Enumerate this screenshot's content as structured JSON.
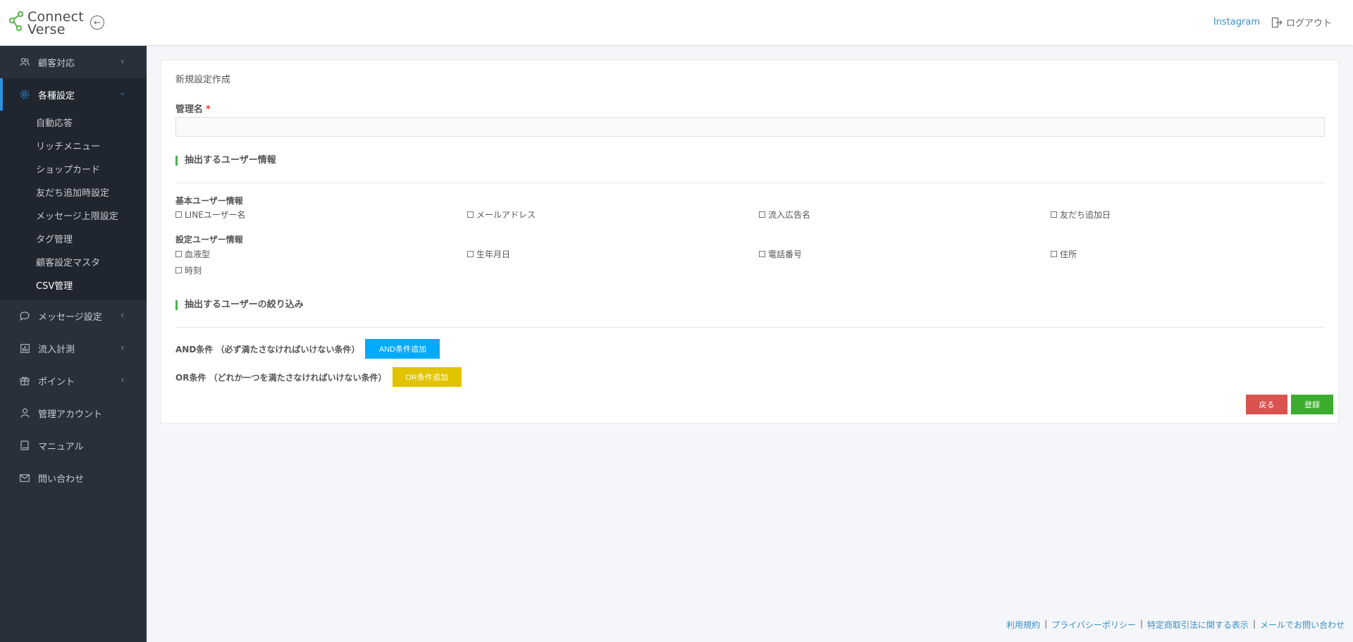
{
  "header": {
    "logo_line1": "Connect",
    "logo_line2": "Verse",
    "instagram_link": "Instagram",
    "logout_label": "ログアウト"
  },
  "sidebar": {
    "items": [
      {
        "label": "顧客対応",
        "icon": "users-icon"
      },
      {
        "label": "各種設定",
        "icon": "gear-icon",
        "active": true
      },
      {
        "label": "メッセージ設定",
        "icon": "chat-icon"
      },
      {
        "label": "流入計測",
        "icon": "chart-icon"
      },
      {
        "label": "ポイント",
        "icon": "gift-icon"
      },
      {
        "label": "管理アカウント",
        "icon": "user-icon"
      },
      {
        "label": "マニュアル",
        "icon": "book-icon"
      },
      {
        "label": "問い合わせ",
        "icon": "mail-icon"
      }
    ],
    "sub_items": [
      "自動応答",
      "リッチメニュー",
      "ショップカード",
      "友だち追加時設定",
      "メッセージ上限設定",
      "タグ管理",
      "顧客設定マスタ",
      "CSV管理"
    ]
  },
  "form": {
    "title": "新規設定作成",
    "name_label": "管理名",
    "required_mark": "*",
    "name_value": "",
    "section_extract": "抽出するユーザー情報",
    "basic_group": "基本ユーザー情報",
    "basic_options": [
      "LINEユーザー名",
      "メールアドレス",
      "流入広告名",
      "友だち追加日"
    ],
    "settings_group": "設定ユーザー情報",
    "settings_options": [
      "血液型",
      "生年月日",
      "電話番号",
      "住所",
      "時刻"
    ],
    "section_filter": "抽出するユーザーの絞り込み",
    "and_label": "AND条件 （必ず満たさなければいけない条件）",
    "and_button": "AND条件追加",
    "or_label": "OR条件 （どれか一つを満たさなければいけない条件）",
    "or_button": "OR条件追加",
    "back_button": "戻る",
    "submit_button": "登録"
  },
  "footer": {
    "links": [
      "利用規約",
      "プライバシーポリシー",
      "特定商取引法に関する表示",
      "メールでお問い合わせ"
    ]
  },
  "colors": {
    "sidebar_bg": "#28303b",
    "accent_blue": "#2f8fdd",
    "and_button": "#00aaff",
    "or_button": "#e1c300",
    "back_button": "#d9534f",
    "submit_button": "#3cab2e",
    "section_bar": "#4caf50"
  }
}
